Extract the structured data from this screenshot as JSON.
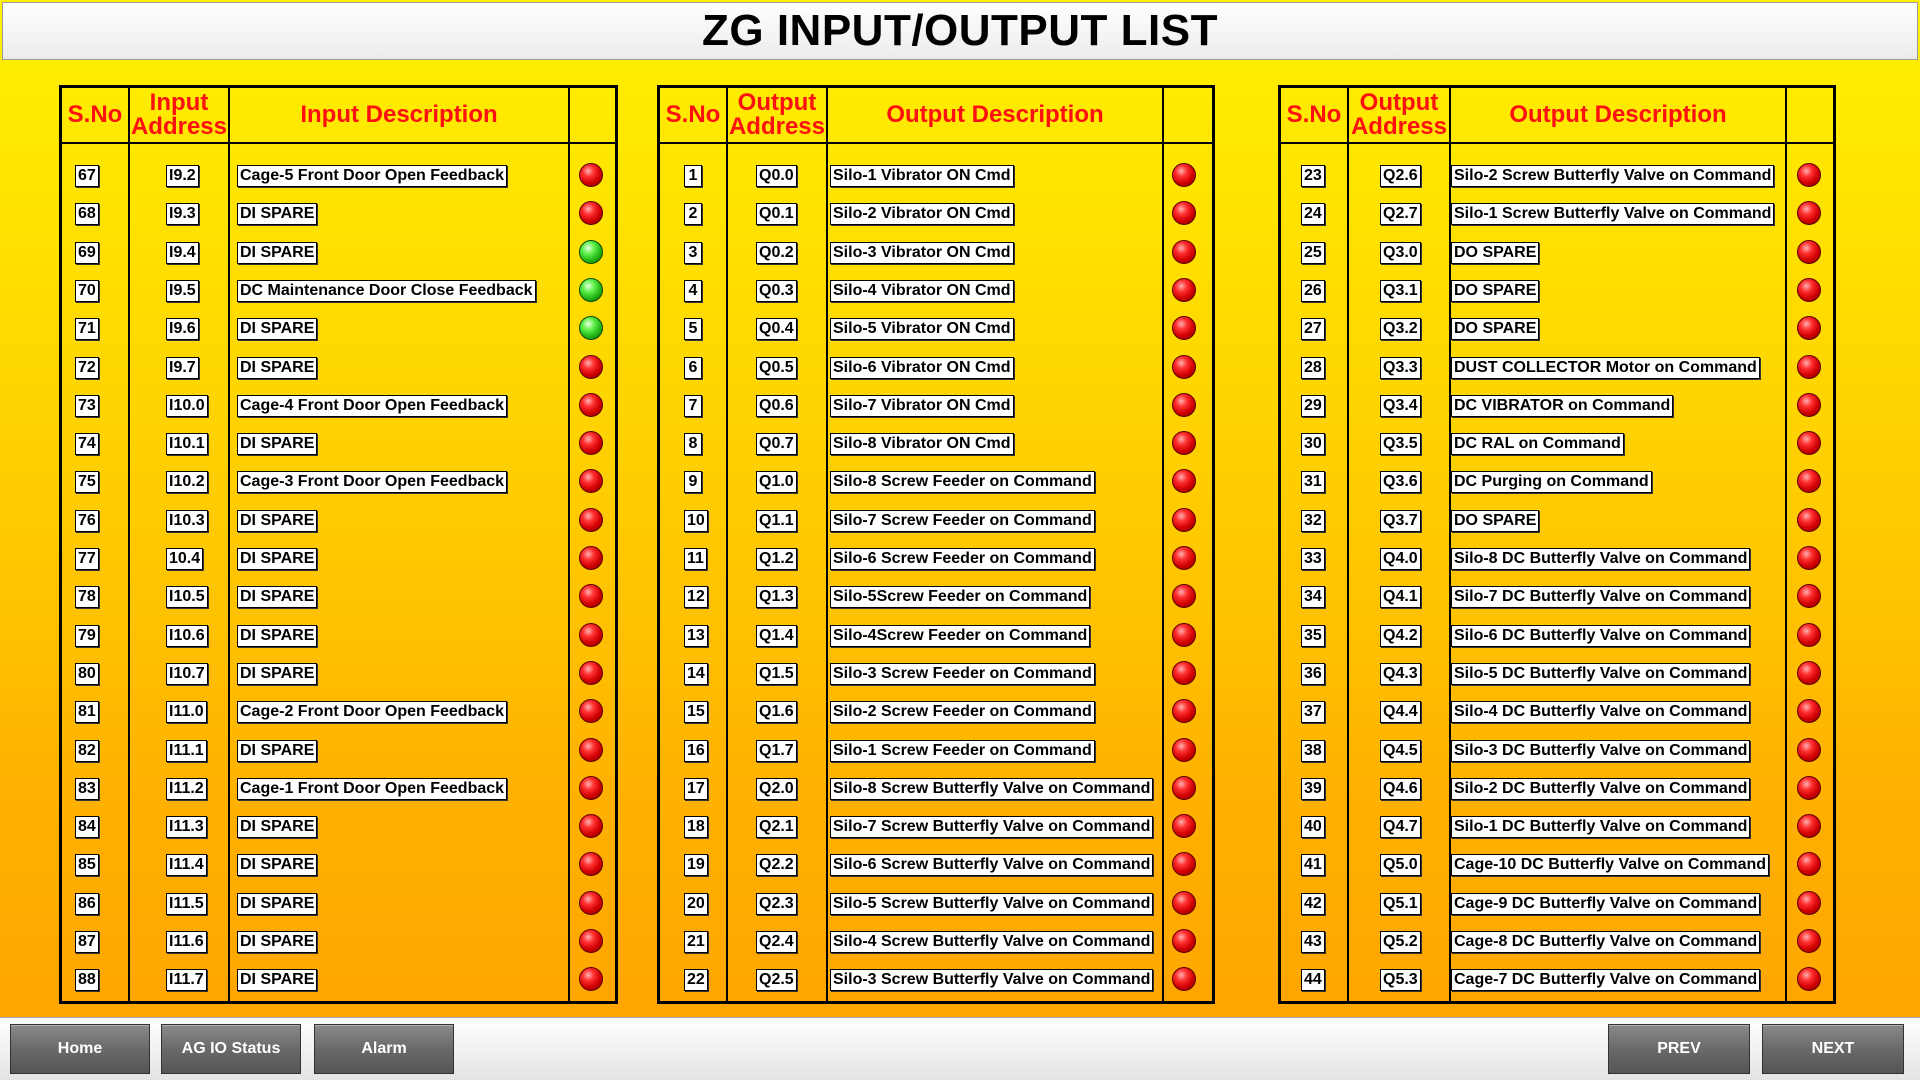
{
  "title": "ZG INPUT/OUTPUT LIST",
  "colors": {
    "header_text": "#ff1010",
    "lamp_off": "red",
    "lamp_on": "green"
  },
  "panels": [
    {
      "headers": {
        "sno": "S.No",
        "address": "Input Address",
        "description": "Input Description"
      },
      "rows": [
        {
          "sno": "67",
          "addr": "I9.2",
          "desc": "Cage-5 Front Door Open Feedback",
          "status": "red"
        },
        {
          "sno": "68",
          "addr": "I9.3",
          "desc": "DI SPARE",
          "status": "red"
        },
        {
          "sno": "69",
          "addr": "I9.4",
          "desc": "DI SPARE",
          "status": "green"
        },
        {
          "sno": "70",
          "addr": "I9.5",
          "desc": "DC Maintenance Door Close Feedback",
          "status": "green"
        },
        {
          "sno": "71",
          "addr": "I9.6",
          "desc": "DI SPARE",
          "status": "green"
        },
        {
          "sno": "72",
          "addr": "I9.7",
          "desc": "DI SPARE",
          "status": "red"
        },
        {
          "sno": "73",
          "addr": "I10.0",
          "desc": "Cage-4 Front Door Open Feedback",
          "status": "red"
        },
        {
          "sno": "74",
          "addr": "I10.1",
          "desc": "DI SPARE",
          "status": "red"
        },
        {
          "sno": "75",
          "addr": "I10.2",
          "desc": "Cage-3 Front Door Open Feedback",
          "status": "red"
        },
        {
          "sno": "76",
          "addr": "I10.3",
          "desc": "DI SPARE",
          "status": "red"
        },
        {
          "sno": "77",
          "addr": "10.4",
          "desc": "DI SPARE",
          "status": "red"
        },
        {
          "sno": "78",
          "addr": "I10.5",
          "desc": "DI SPARE",
          "status": "red"
        },
        {
          "sno": "79",
          "addr": "I10.6",
          "desc": "DI SPARE",
          "status": "red"
        },
        {
          "sno": "80",
          "addr": "I10.7",
          "desc": "DI SPARE",
          "status": "red"
        },
        {
          "sno": "81",
          "addr": "I11.0",
          "desc": "Cage-2 Front Door Open Feedback",
          "status": "red"
        },
        {
          "sno": "82",
          "addr": "I11.1",
          "desc": "DI SPARE",
          "status": "red"
        },
        {
          "sno": "83",
          "addr": "I11.2",
          "desc": "Cage-1 Front Door Open Feedback",
          "status": "red"
        },
        {
          "sno": "84",
          "addr": "I11.3",
          "desc": "DI SPARE",
          "status": "red"
        },
        {
          "sno": "85",
          "addr": "I11.4",
          "desc": "DI SPARE",
          "status": "red"
        },
        {
          "sno": "86",
          "addr": "I11.5",
          "desc": "DI SPARE",
          "status": "red"
        },
        {
          "sno": "87",
          "addr": "I11.6",
          "desc": "DI SPARE",
          "status": "red"
        },
        {
          "sno": "88",
          "addr": "I11.7",
          "desc": "DI SPARE",
          "status": "red"
        }
      ]
    },
    {
      "headers": {
        "sno": "S.No",
        "address": "Output Address",
        "description": "Output Description"
      },
      "rows": [
        {
          "sno": "1",
          "addr": "Q0.0",
          "desc": "Silo-1 Vibrator ON Cmd",
          "status": "red"
        },
        {
          "sno": "2",
          "addr": "Q0.1",
          "desc": "Silo-2 Vibrator ON Cmd",
          "status": "red"
        },
        {
          "sno": "3",
          "addr": "Q0.2",
          "desc": "Silo-3 Vibrator ON Cmd",
          "status": "red"
        },
        {
          "sno": "4",
          "addr": "Q0.3",
          "desc": "Silo-4 Vibrator ON Cmd",
          "status": "red"
        },
        {
          "sno": "5",
          "addr": "Q0.4",
          "desc": "Silo-5 Vibrator ON Cmd",
          "status": "red"
        },
        {
          "sno": "6",
          "addr": "Q0.5",
          "desc": "Silo-6 Vibrator ON Cmd",
          "status": "red"
        },
        {
          "sno": "7",
          "addr": "Q0.6",
          "desc": "Silo-7 Vibrator ON Cmd",
          "status": "red"
        },
        {
          "sno": "8",
          "addr": "Q0.7",
          "desc": "Silo-8 Vibrator ON Cmd",
          "status": "red"
        },
        {
          "sno": "9",
          "addr": "Q1.0",
          "desc": "Silo-8 Screw Feeder on Command",
          "status": "red"
        },
        {
          "sno": "10",
          "addr": "Q1.1",
          "desc": "Silo-7 Screw Feeder on Command",
          "status": "red"
        },
        {
          "sno": "11",
          "addr": "Q1.2",
          "desc": "Silo-6 Screw Feeder on Command",
          "status": "red"
        },
        {
          "sno": "12",
          "addr": "Q1.3",
          "desc": "Silo-5Screw Feeder on Command",
          "status": "red"
        },
        {
          "sno": "13",
          "addr": "Q1.4",
          "desc": "Silo-4Screw Feeder on Command",
          "status": "red"
        },
        {
          "sno": "14",
          "addr": "Q1.5",
          "desc": "Silo-3 Screw Feeder on Command",
          "status": "red"
        },
        {
          "sno": "15",
          "addr": "Q1.6",
          "desc": "Silo-2 Screw Feeder on Command",
          "status": "red"
        },
        {
          "sno": "16",
          "addr": "Q1.7",
          "desc": "Silo-1 Screw Feeder on Command",
          "status": "red"
        },
        {
          "sno": "17",
          "addr": "Q2.0",
          "desc": "Silo-8 Screw  Butterfly Valve on Command",
          "status": "red"
        },
        {
          "sno": "18",
          "addr": "Q2.1",
          "desc": "Silo-7 Screw  Butterfly Valve on Command",
          "status": "red"
        },
        {
          "sno": "19",
          "addr": "Q2.2",
          "desc": "Silo-6 Screw  Butterfly Valve on Command",
          "status": "red"
        },
        {
          "sno": "20",
          "addr": "Q2.3",
          "desc": "Silo-5 Screw  Butterfly Valve on Command",
          "status": "red"
        },
        {
          "sno": "21",
          "addr": "Q2.4",
          "desc": "Silo-4 Screw  Butterfly Valve on Command",
          "status": "red"
        },
        {
          "sno": "22",
          "addr": "Q2.5",
          "desc": "Silo-3 Screw  Butterfly Valve on Command",
          "status": "red"
        }
      ]
    },
    {
      "headers": {
        "sno": "S.No",
        "address": "Output Address",
        "description": "Output Description"
      },
      "rows": [
        {
          "sno": "23",
          "addr": "Q2.6",
          "desc": "Silo-2 Screw  Butterfly Valve on Command",
          "status": "red"
        },
        {
          "sno": "24",
          "addr": "Q2.7",
          "desc": "Silo-1 Screw  Butterfly Valve on Command",
          "status": "red"
        },
        {
          "sno": "25",
          "addr": "Q3.0",
          "desc": "DO SPARE",
          "status": "red"
        },
        {
          "sno": "26",
          "addr": "Q3.1",
          "desc": "DO SPARE",
          "status": "red"
        },
        {
          "sno": "27",
          "addr": "Q3.2",
          "desc": "DO SPARE",
          "status": "red"
        },
        {
          "sno": "28",
          "addr": "Q3.3",
          "desc": "DUST COLLECTOR Motor on Command",
          "status": "red"
        },
        {
          "sno": "29",
          "addr": "Q3.4",
          "desc": "DC VIBRATOR on Command",
          "status": "red"
        },
        {
          "sno": "30",
          "addr": "Q3.5",
          "desc": "DC RAL on Command",
          "status": "red"
        },
        {
          "sno": "31",
          "addr": "Q3.6",
          "desc": "DC Purging on Command",
          "status": "red"
        },
        {
          "sno": "32",
          "addr": "Q3.7",
          "desc": "DO SPARE",
          "status": "red"
        },
        {
          "sno": "33",
          "addr": "Q4.0",
          "desc": "Silo-8 DC Butterfly Valve on Command",
          "status": "red"
        },
        {
          "sno": "34",
          "addr": "Q4.1",
          "desc": "Silo-7 DC Butterfly Valve on Command",
          "status": "red"
        },
        {
          "sno": "35",
          "addr": "Q4.2",
          "desc": "Silo-6 DC Butterfly Valve on Command",
          "status": "red"
        },
        {
          "sno": "36",
          "addr": "Q4.3",
          "desc": "Silo-5 DC Butterfly Valve on Command",
          "status": "red"
        },
        {
          "sno": "37",
          "addr": "Q4.4",
          "desc": "Silo-4 DC Butterfly Valve on Command",
          "status": "red"
        },
        {
          "sno": "38",
          "addr": "Q4.5",
          "desc": "Silo-3 DC Butterfly Valve on Command",
          "status": "red"
        },
        {
          "sno": "39",
          "addr": "Q4.6",
          "desc": "Silo-2 DC Butterfly Valve on Command",
          "status": "red"
        },
        {
          "sno": "40",
          "addr": "Q4.7",
          "desc": "Silo-1 DC Butterfly Valve on Command",
          "status": "red"
        },
        {
          "sno": "41",
          "addr": "Q5.0",
          "desc": "Cage-10 DC Butterfly Valve on Command",
          "status": "red"
        },
        {
          "sno": "42",
          "addr": "Q5.1",
          "desc": "Cage-9 DC Butterfly Valve on Command",
          "status": "red"
        },
        {
          "sno": "43",
          "addr": "Q5.2",
          "desc": "Cage-8 DC Butterfly Valve on Command",
          "status": "red"
        },
        {
          "sno": "44",
          "addr": "Q5.3",
          "desc": "Cage-7 DC Butterfly Valve on Command",
          "status": "red"
        }
      ]
    }
  ],
  "footer": {
    "home": "Home",
    "ag_io_status": "AG IO Status",
    "alarm": "Alarm",
    "prev": "PREV",
    "next": "NEXT"
  }
}
